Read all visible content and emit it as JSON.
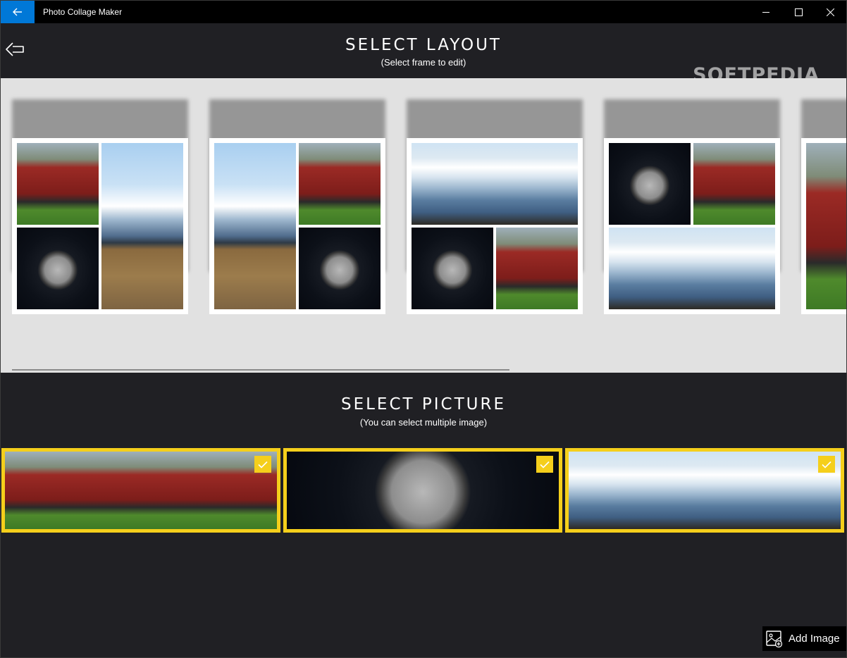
{
  "window": {
    "title": "Photo Collage Maker",
    "controls": [
      "minimize",
      "maximize",
      "close"
    ]
  },
  "header": {
    "title": "SELECT LAYOUT",
    "subtitle": "(Select frame to edit)",
    "watermark": "SOFTPEDIA"
  },
  "layouts": [
    {
      "name": "layout-1",
      "cells": [
        "car",
        "road",
        "moon"
      ]
    },
    {
      "name": "layout-2",
      "cells": [
        "road",
        "car",
        "moon"
      ]
    },
    {
      "name": "layout-3",
      "cells": [
        "mountain",
        "moon",
        "car"
      ]
    },
    {
      "name": "layout-4",
      "cells": [
        "moon",
        "car",
        "mountain"
      ]
    },
    {
      "name": "layout-5",
      "cells": [
        "car"
      ]
    }
  ],
  "pictures": {
    "title": "SELECT PICTURE",
    "subtitle": "(You can select multiple image)",
    "items": [
      {
        "name": "car",
        "selected": true
      },
      {
        "name": "moon",
        "selected": true
      },
      {
        "name": "mountain",
        "selected": true
      }
    ],
    "selection_color": "#f5cf1b"
  },
  "add_button": {
    "label": "Add Image",
    "icon": "add-image-icon"
  },
  "colors": {
    "accent": "#0078d7",
    "background": "#202024",
    "strip": "#e1e1e1"
  }
}
